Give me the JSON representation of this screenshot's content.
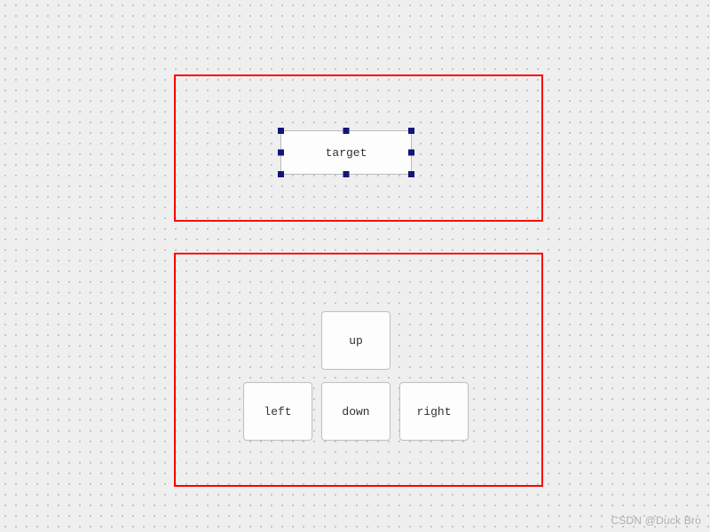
{
  "target": {
    "label": "target"
  },
  "buttons": {
    "up": "up",
    "left": "left",
    "down": "down",
    "right": "right"
  },
  "watermark": "CSDN @Duck Bro"
}
